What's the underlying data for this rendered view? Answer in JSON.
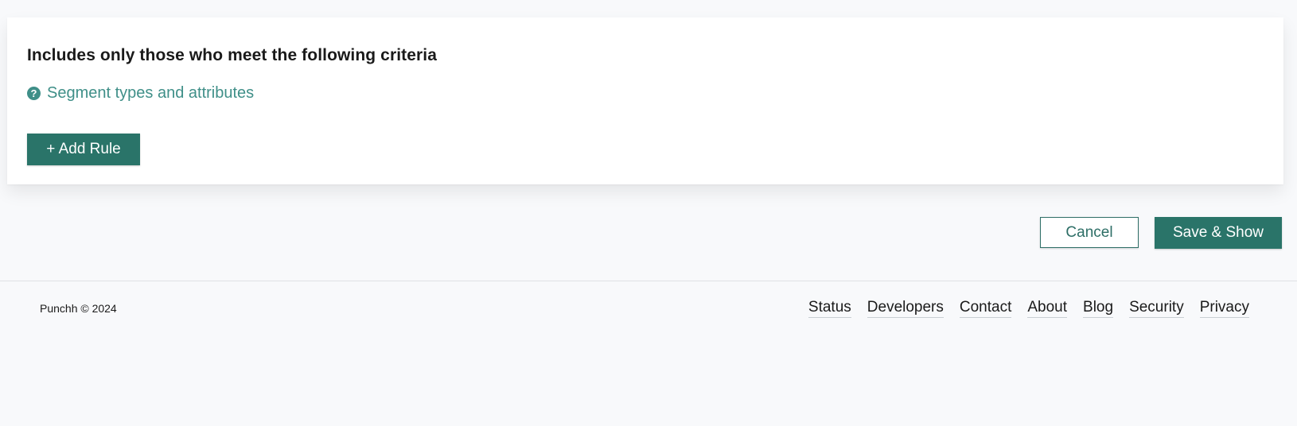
{
  "segment_card": {
    "title": "Includes only those who meet the following criteria",
    "help_link_label": "Segment types and attributes",
    "add_rule_label": "+ Add Rule"
  },
  "actions": {
    "cancel_label": "Cancel",
    "save_label": "Save & Show"
  },
  "footer": {
    "copyright": "Punchh © 2024",
    "links": [
      "Status",
      "Developers",
      "Contact",
      "About",
      "Blog",
      "Security",
      "Privacy"
    ]
  },
  "colors": {
    "primary": "#2a7469",
    "link": "#3f8f88",
    "background": "#f8f9fb"
  }
}
